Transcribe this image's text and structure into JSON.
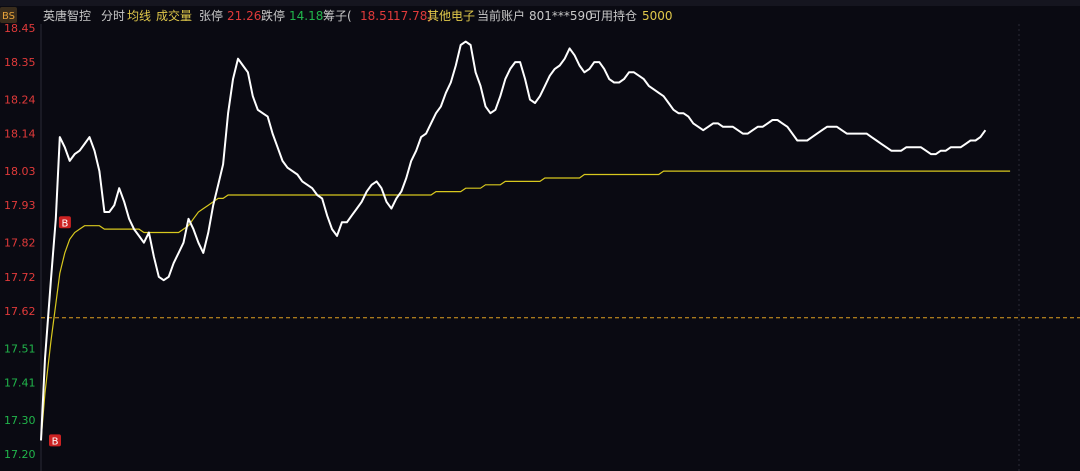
{
  "header": {
    "badge": "BS",
    "stock_name": "英唐智控",
    "tab_fenshi": "分时",
    "tab_junxian": "均线",
    "tab_volume": "成交量",
    "zhangting_label": "张停",
    "zhangting_value": "21.26",
    "dieting_label": "跌停",
    "dieting_value": "14.18",
    "chouzi_label": "筹子(",
    "chouzi_v1": "18.51",
    "chouzi_v2": "17.78)",
    "other_label": "其他电子",
    "account_label": "当前账户",
    "account_value": "801***590",
    "holding_label": "可用持仓",
    "holding_value": "5000"
  },
  "colors": {
    "background": "#0a0a12",
    "price_line": "#ffffff",
    "avg_line": "#d8c81e",
    "ref_line": "#e0a020",
    "up_text": "#e03a3a",
    "down_text": "#21b54b",
    "neutral_text": "#c8c8c8",
    "yellow_text": "#e0c84a",
    "marker_bg": "#cc2222"
  },
  "chart_data": {
    "type": "line",
    "title": "",
    "ylim": [
      17.2,
      18.45
    ],
    "reference_price": 17.6,
    "y_ticks": [
      "18.45",
      "18.35",
      "18.24",
      "18.14",
      "18.03",
      "17.93",
      "17.82",
      "17.72",
      "17.62",
      "17.51",
      "17.41",
      "17.30",
      "17.20"
    ],
    "x": [
      0,
      4,
      10,
      15,
      19,
      24,
      29,
      34,
      39,
      44,
      49,
      54,
      59,
      64,
      69,
      74,
      79,
      84,
      89,
      94,
      99,
      104,
      109,
      114,
      119,
      124,
      129,
      134,
      139,
      144,
      149,
      154,
      159,
      164,
      169,
      174,
      179,
      184,
      189,
      194,
      199,
      204,
      209,
      214,
      219,
      224,
      229,
      234,
      239,
      244,
      249,
      254,
      259,
      264,
      269,
      274,
      279,
      284,
      289,
      294,
      299,
      304,
      309,
      314,
      319,
      324,
      329,
      334,
      339,
      344,
      349,
      354,
      359,
      364,
      369,
      374,
      379,
      384,
      389,
      394,
      399,
      404,
      409,
      414,
      419,
      424,
      429,
      434,
      439,
      444,
      449,
      454,
      459,
      464,
      469,
      474,
      479,
      484,
      489,
      494,
      499,
      504,
      509,
      514,
      519,
      524,
      529,
      534,
      539,
      544,
      549,
      554,
      559,
      564,
      569,
      574,
      579,
      584,
      589,
      594,
      599,
      604,
      609,
      614,
      619,
      624,
      629,
      634,
      639,
      644,
      649,
      654,
      659,
      664,
      669,
      674,
      679,
      684,
      689,
      694,
      699,
      704,
      709,
      714,
      719,
      724,
      729,
      734,
      739,
      744,
      749,
      754,
      759,
      764,
      769,
      774,
      779,
      784,
      789,
      794,
      799,
      804,
      809,
      814,
      819,
      824,
      829,
      834,
      839,
      844,
      849,
      854,
      859,
      864,
      869,
      874,
      879,
      884,
      889,
      894,
      899,
      904,
      909,
      914,
      919,
      924,
      929,
      934,
      939,
      944,
      949,
      954,
      959,
      964,
      969,
      974,
      979,
      984,
      989
    ],
    "series": [
      {
        "values": [
          17.24,
          17.48,
          17.71,
          17.89,
          18.13,
          18.1,
          18.06,
          18.08,
          18.09,
          18.11,
          18.13,
          18.09,
          18.03,
          17.91,
          17.91,
          17.93,
          17.98,
          17.94,
          17.89,
          17.86,
          17.84,
          17.82,
          17.85,
          17.78,
          17.72,
          17.71,
          17.72,
          17.76,
          17.79,
          17.82,
          17.89,
          17.86,
          17.82,
          17.79,
          17.85,
          17.93,
          17.99,
          18.05,
          18.2,
          18.3,
          18.36,
          18.34,
          18.32,
          18.25,
          18.21,
          18.2,
          18.19,
          18.14,
          18.1,
          18.06,
          18.04,
          18.03,
          18.02,
          18.0,
          17.99,
          17.98,
          17.96,
          17.95,
          17.9,
          17.86,
          17.84,
          17.88,
          17.88,
          17.9,
          17.92,
          17.94,
          17.97,
          17.99,
          18.0,
          17.98,
          17.94,
          17.92,
          17.95,
          17.97,
          18.01,
          18.06,
          18.09,
          18.13,
          18.14,
          18.17,
          18.2,
          18.22,
          18.26,
          18.29,
          18.34,
          18.4,
          18.41,
          18.4,
          18.32,
          18.28,
          18.22,
          18.2,
          18.21,
          18.25,
          18.3,
          18.33,
          18.35,
          18.35,
          18.3,
          18.24,
          18.23,
          18.25,
          18.28,
          18.31,
          18.33,
          18.34,
          18.36,
          18.39,
          18.37,
          18.34,
          18.32,
          18.33,
          18.35,
          18.35,
          18.33,
          18.3,
          18.29,
          18.29,
          18.3,
          18.32,
          18.32,
          18.31,
          18.3,
          18.28,
          18.27,
          18.26,
          18.25,
          18.23,
          18.21,
          18.2,
          18.2,
          18.19,
          18.17,
          18.16,
          18.15,
          18.16,
          18.17,
          18.17,
          18.16,
          18.16,
          18.16,
          18.15,
          18.14,
          18.14,
          18.15,
          18.16,
          18.16,
          18.17,
          18.18,
          18.18,
          18.17,
          18.16,
          18.14,
          18.12,
          18.12,
          18.12,
          18.13,
          18.14,
          18.15,
          18.16,
          18.16,
          18.16,
          18.15,
          18.14,
          18.14,
          18.14,
          18.14,
          18.14,
          18.13,
          18.12,
          18.11,
          18.1,
          18.09,
          18.09,
          18.09,
          18.1,
          18.1,
          18.1,
          18.1,
          18.09,
          18.08,
          18.08,
          18.09,
          18.09,
          18.1,
          18.1,
          18.1,
          18.11,
          18.12,
          18.12,
          18.13,
          18.15
        ]
      },
      {
        "values": [
          17.24,
          17.38,
          17.53,
          17.64,
          17.73,
          17.79,
          17.83,
          17.85,
          17.86,
          17.87,
          17.87,
          17.87,
          17.87,
          17.86,
          17.86,
          17.86,
          17.86,
          17.86,
          17.86,
          17.86,
          17.86,
          17.85,
          17.85,
          17.85,
          17.85,
          17.85,
          17.85,
          17.85,
          17.85,
          17.86,
          17.87,
          17.89,
          17.91,
          17.92,
          17.93,
          17.94,
          17.95,
          17.95,
          17.96,
          17.96,
          17.96,
          17.96,
          17.96,
          17.96,
          17.96,
          17.96,
          17.96,
          17.96,
          17.96,
          17.96,
          17.96,
          17.96,
          17.96,
          17.96,
          17.96,
          17.96,
          17.96,
          17.96,
          17.96,
          17.96,
          17.96,
          17.96,
          17.96,
          17.96,
          17.96,
          17.96,
          17.96,
          17.96,
          17.96,
          17.96,
          17.96,
          17.96,
          17.96,
          17.96,
          17.96,
          17.96,
          17.96,
          17.96,
          17.96,
          17.96,
          17.97,
          17.97,
          17.97,
          17.97,
          17.97,
          17.97,
          17.98,
          17.98,
          17.98,
          17.98,
          17.99,
          17.99,
          17.99,
          17.99,
          18.0,
          18.0,
          18.0,
          18.0,
          18.0,
          18.0,
          18.0,
          18.0,
          18.01,
          18.01,
          18.01,
          18.01,
          18.01,
          18.01,
          18.01,
          18.01,
          18.02,
          18.02,
          18.02,
          18.02,
          18.02,
          18.02,
          18.02,
          18.02,
          18.02,
          18.02,
          18.02,
          18.02,
          18.02,
          18.02,
          18.02,
          18.02,
          18.03,
          18.03,
          18.03,
          18.03,
          18.03,
          18.03,
          18.03,
          18.03,
          18.03,
          18.03,
          18.03,
          18.03,
          18.03,
          18.03,
          18.03,
          18.03,
          18.03,
          18.03,
          18.03,
          18.03,
          18.03,
          18.03,
          18.03,
          18.03,
          18.03,
          18.03,
          18.03,
          18.03,
          18.03,
          18.03,
          18.03,
          18.03,
          18.03,
          18.03,
          18.03,
          18.03,
          18.03,
          18.03,
          18.03,
          18.03,
          18.03,
          18.03,
          18.03,
          18.03,
          18.03,
          18.03,
          18.03,
          18.03,
          18.03,
          18.03,
          18.03,
          18.03,
          18.03,
          18.03,
          18.03,
          18.03,
          18.03,
          18.03,
          18.03,
          18.03,
          18.03,
          18.03,
          18.03,
          18.03,
          18.03,
          18.03,
          18.03,
          18.03,
          18.03,
          18.03,
          18.03
        ]
      }
    ],
    "markers": [
      {
        "label": "B",
        "x": 0,
        "y": 17.24
      },
      {
        "label": "B",
        "x": 10,
        "y": 17.88
      }
    ]
  }
}
